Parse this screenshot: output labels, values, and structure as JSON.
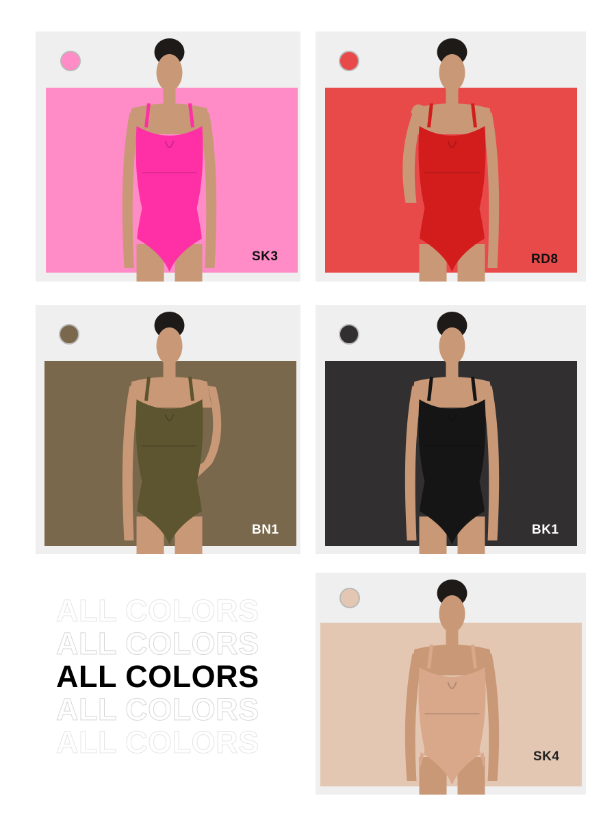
{
  "cards": [
    {
      "code": "SK3",
      "swatch": "#ff8cc6",
      "panel": "#ff8cc6",
      "garment": "#ff2fa6",
      "code_color": "#111111"
    },
    {
      "code": "RD8",
      "swatch": "#e84a4a",
      "panel": "#e84a4a",
      "garment": "#d31d1d",
      "code_color": "#111111"
    },
    {
      "code": "BN1",
      "swatch": "#7a684c",
      "panel": "#7a684c",
      "garment": "#5d5530",
      "code_color": "#ffffff"
    },
    {
      "code": "BK1",
      "swatch": "#312f30",
      "panel": "#312f30",
      "garment": "#151515",
      "code_color": "#ffffff"
    },
    {
      "code": "SK4",
      "swatch": "#e3c7b2",
      "panel": "#e3c7b2",
      "garment": "#d9a88a",
      "code_color": "#222222"
    }
  ],
  "headline": {
    "lines": [
      "ALL COLORS",
      "ALL COLORS",
      "ALL COLORS",
      "ALL COLORS",
      "ALL COLORS"
    ]
  },
  "icons": {
    "model": "model-photo-icon"
  }
}
